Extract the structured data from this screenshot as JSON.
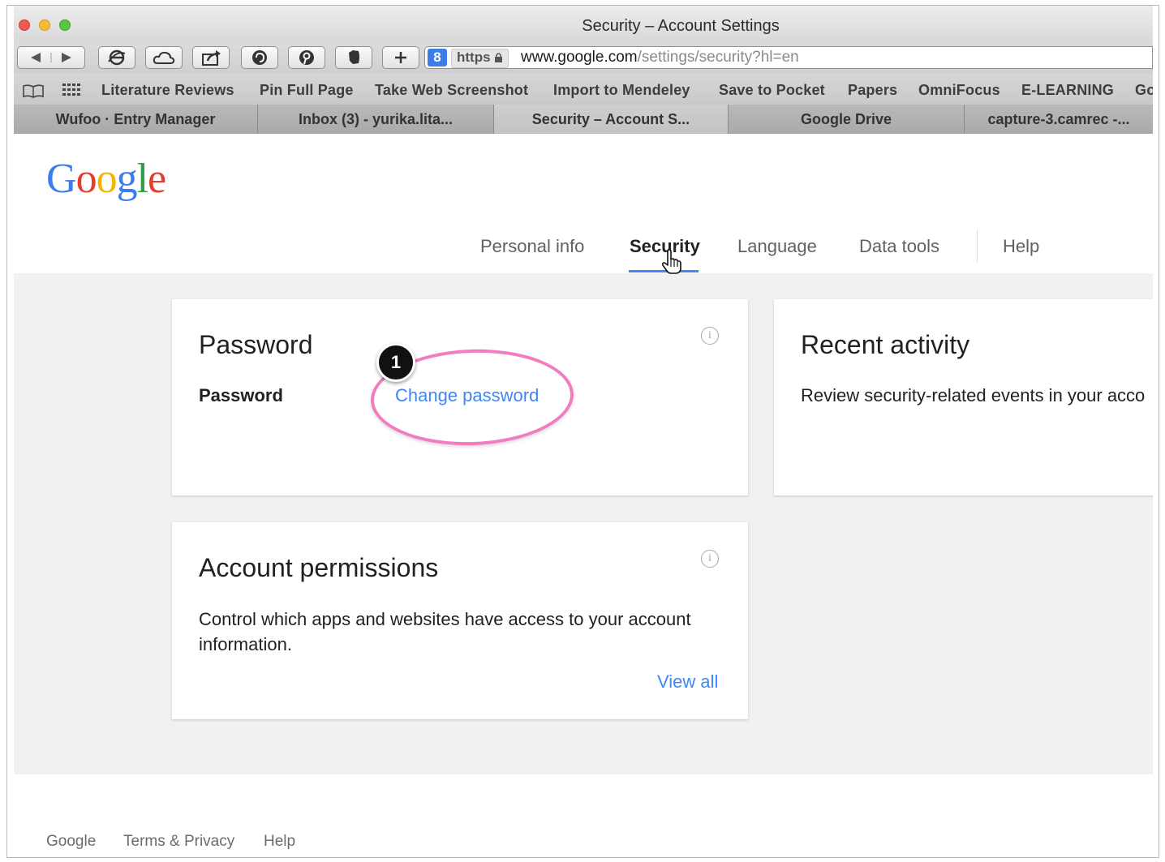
{
  "window": {
    "title": "Security – Account Settings"
  },
  "address": {
    "scheme": "https",
    "domain": "www.google.com",
    "path": "/settings/security?hl=en"
  },
  "bookmarks": [
    "Literature Reviews",
    "Pin Full Page",
    "Take Web Screenshot",
    "Import to Mendeley",
    "Save to Pocket",
    "Papers",
    "OmniFocus",
    "E-LEARNING",
    "Go"
  ],
  "tabs": [
    "Wufoo · Entry Manager",
    "Inbox (3) - yurika.lita...",
    "Security – Account S...",
    "Google Drive",
    "capture-3.camrec -..."
  ],
  "logo": {
    "letters": [
      "G",
      "o",
      "o",
      "g",
      "l",
      "e"
    ],
    "colors": [
      "#3b7ded",
      "#e2402f",
      "#f4b400",
      "#3b7ded",
      "#2c9e4b",
      "#e2402f"
    ]
  },
  "nav": {
    "personal": "Personal info",
    "security": "Security",
    "language": "Language",
    "data_tools": "Data tools",
    "help": "Help"
  },
  "password_card": {
    "title": "Password",
    "label": "Password",
    "link": "Change password",
    "info": "i"
  },
  "activity_card": {
    "title": "Recent activity",
    "text": "Review security-related events in your acco"
  },
  "permissions_card": {
    "title": "Account permissions",
    "text": "Control which apps and websites have access to your account information.",
    "link": "View all",
    "info": "i"
  },
  "footer": {
    "google": "Google",
    "terms": "Terms & Privacy",
    "help": "Help"
  },
  "annotation": {
    "step": "1",
    "color": "#f37bbf"
  }
}
